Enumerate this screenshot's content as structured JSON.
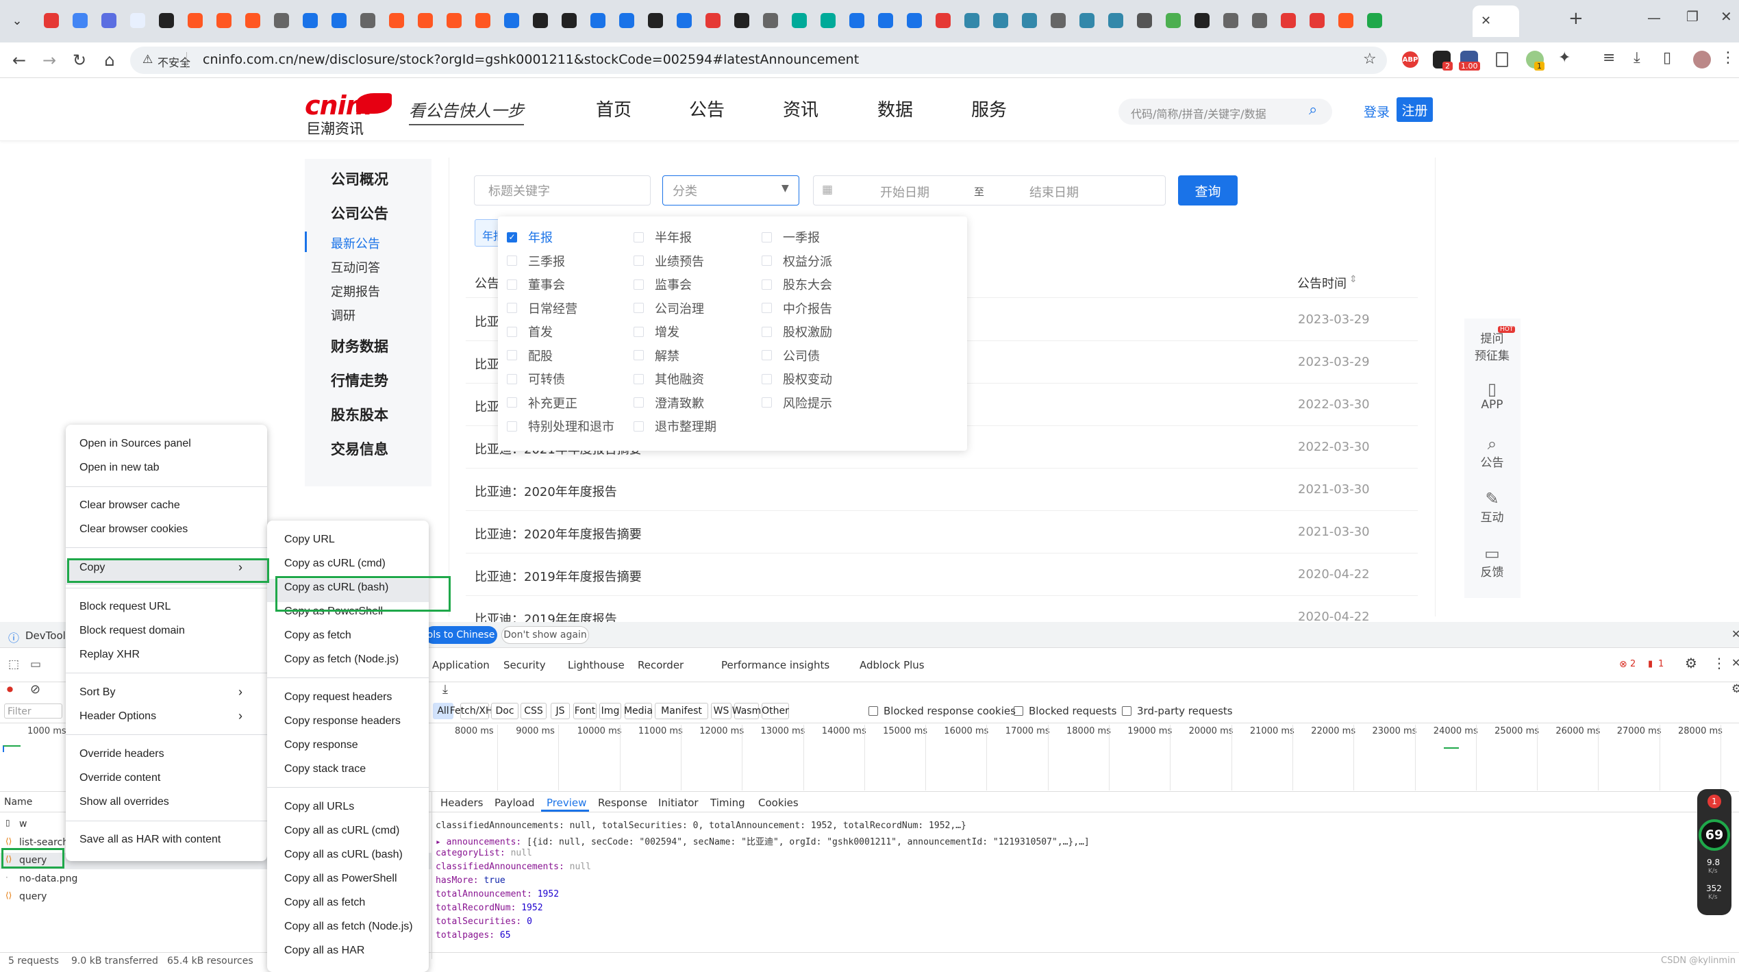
{
  "browser": {
    "url": "cninfo.com.cn/new/disclosure/stock?orgId=gshk0001211&stockCode=002594#latestAnnouncement",
    "security_label": "不安全",
    "new_tab_symbol": "+",
    "ext_badges": {
      "a": "2",
      "b": "1.00",
      "c": "1"
    }
  },
  "site": {
    "logo_text": "cninf",
    "logo_sub": "巨潮资讯",
    "slogan": "看公告快人一步",
    "menu": [
      "首页",
      "公告",
      "资讯",
      "数据",
      "服务"
    ],
    "search_placeholder": "代码/简称/拼音/关键字/数据",
    "login": "登录",
    "register": "注册"
  },
  "leftnav": {
    "items": [
      "公司概况",
      "公司公告",
      "最新公告",
      "互动问答",
      "定期报告",
      "调研",
      "财务数据",
      "行情走势",
      "股东股本",
      "交易信息"
    ]
  },
  "filters": {
    "keyword_placeholder": "标题关键字",
    "category_placeholder": "分类",
    "start_date": "开始日期",
    "to": "至",
    "end_date": "结束日期",
    "query_button": "查询",
    "selected_tag": "年报"
  },
  "categories": [
    [
      "年报",
      "半年报",
      "一季报"
    ],
    [
      "三季报",
      "业绩预告",
      "权益分派"
    ],
    [
      "董事会",
      "监事会",
      "股东大会"
    ],
    [
      "日常经营",
      "公司治理",
      "中介报告"
    ],
    [
      "首发",
      "增发",
      "股权激励"
    ],
    [
      "配股",
      "解禁",
      "公司债"
    ],
    [
      "可转债",
      "其他融资",
      "股权变动"
    ],
    [
      "补充更正",
      "澄清致歉",
      "风险提示"
    ],
    [
      "特别处理和退市",
      "退市整理期",
      ""
    ]
  ],
  "table": {
    "col_title": "公告",
    "col_time": "公告时间",
    "rows": [
      {
        "title": "比亚",
        "date": "2023-03-29"
      },
      {
        "title": "比亚",
        "date": "2023-03-29"
      },
      {
        "title": "比亚",
        "date": "2022-03-30"
      },
      {
        "title": "比亚迪：2021年年度报告摘要",
        "date": "2022-03-30"
      },
      {
        "title": "比亚迪：2020年年度报告",
        "date": "2021-03-30"
      },
      {
        "title": "比亚迪：2020年年度报告摘要",
        "date": "2021-03-30"
      },
      {
        "title": "比亚迪：2019年年度报告摘要",
        "date": "2020-04-22"
      },
      {
        "title": "比亚迪：2019年年度报告",
        "date": "2020-04-22"
      }
    ]
  },
  "sidebar": [
    {
      "icon": "hot-icon",
      "label1": "提问",
      "label2": "预征集",
      "badge": "HOT"
    },
    {
      "icon": "phone-icon",
      "label1": "APP",
      "label2": ""
    },
    {
      "icon": "doc-search-icon",
      "label1": "公告",
      "label2": ""
    },
    {
      "icon": "edit-icon",
      "label1": "互动",
      "label2": ""
    },
    {
      "icon": "chat-icon",
      "label1": "反馈",
      "label2": ""
    }
  ],
  "context_menu": {
    "items": [
      "Open in Sources panel",
      "Open in new tab",
      "Clear browser cache",
      "Clear browser cookies",
      "Copy",
      "Block request URL",
      "Block request domain",
      "Replay XHR",
      "Sort By",
      "Header Options",
      "Override headers",
      "Override content",
      "Show all overrides",
      "Save all as HAR with content"
    ]
  },
  "copy_submenu": {
    "items": [
      "Copy URL",
      "Copy as cURL (cmd)",
      "Copy as cURL (bash)",
      "Copy as PowerShell",
      "Copy as fetch",
      "Copy as fetch (Node.js)",
      "Copy request headers",
      "Copy response headers",
      "Copy response",
      "Copy stack trace",
      "Copy all URLs",
      "Copy all as cURL (cmd)",
      "Copy all as cURL (bash)",
      "Copy all as PowerShell",
      "Copy all as fetch",
      "Copy all as fetch (Node.js)",
      "Copy all as HAR"
    ]
  },
  "devtools": {
    "title": "DevTools",
    "lang_button": "ols to Chinese",
    "dont_show": "Don't show again",
    "panels": [
      "Application",
      "Security",
      "Lighthouse",
      "Recorder",
      "Performance insights",
      "Adblock Plus"
    ],
    "errors": "2",
    "warnings": "1",
    "filter_placeholder": "Filter",
    "type_filters": [
      "All",
      "Fetch/XHR",
      "Doc",
      "CSS",
      "JS",
      "Font",
      "Img",
      "Media",
      "Manifest",
      "WS",
      "Wasm",
      "Other"
    ],
    "checkbox_filters": [
      "Blocked response cookies",
      "Blocked requests",
      "3rd-party requests"
    ],
    "timeline": [
      "1000 ms",
      "8000 ms",
      "9000 ms",
      "10000 ms",
      "11000 ms",
      "12000 ms",
      "13000 ms",
      "14000 ms",
      "15000 ms",
      "16000 ms",
      "17000 ms",
      "18000 ms",
      "19000 ms",
      "20000 ms",
      "21000 ms",
      "22000 ms",
      "23000 ms",
      "24000 ms",
      "25000 ms",
      "26000 ms",
      "27000 ms",
      "28000 ms"
    ],
    "name_header": "Name",
    "requests": [
      "w",
      "list-search",
      "query",
      "no-data.png",
      "query"
    ],
    "detail_tabs": [
      "Headers",
      "Payload",
      "Preview",
      "Response",
      "Initiator",
      "Timing",
      "Cookies"
    ],
    "active_detail_tab": "Preview",
    "preview": {
      "summary": "classifiedAnnouncements: null, totalSecurities: 0, totalAnnouncement: 1952, totalRecordNum: 1952,…}",
      "announcements": "[{id: null, secCode: \"002594\", secName: \"比亚迪\", orgId: \"gshk0001211\", announcementId: \"1219310507\",…},…]",
      "categoryList": "null",
      "classifiedAnnouncements": "null",
      "hasMore": "true",
      "totalAnnouncement": "1952",
      "totalRecordNum": "1952",
      "totalSecurities": "0",
      "totalpages": "65"
    },
    "status": [
      "5 requests",
      "9.0 kB transferred",
      "65.4 kB resources"
    ]
  },
  "widget": {
    "badge": "1",
    "percent": "69",
    "up": "9.8",
    "up_unit": "K/s",
    "down": "352",
    "down_unit": "K/s"
  },
  "watermark": "CSDN @kylinmin",
  "colors": {
    "accent": "#1a73e8",
    "logo_red": "#e60012",
    "highlight": "#1fa84a",
    "dev_blue": "#1a73e8"
  }
}
